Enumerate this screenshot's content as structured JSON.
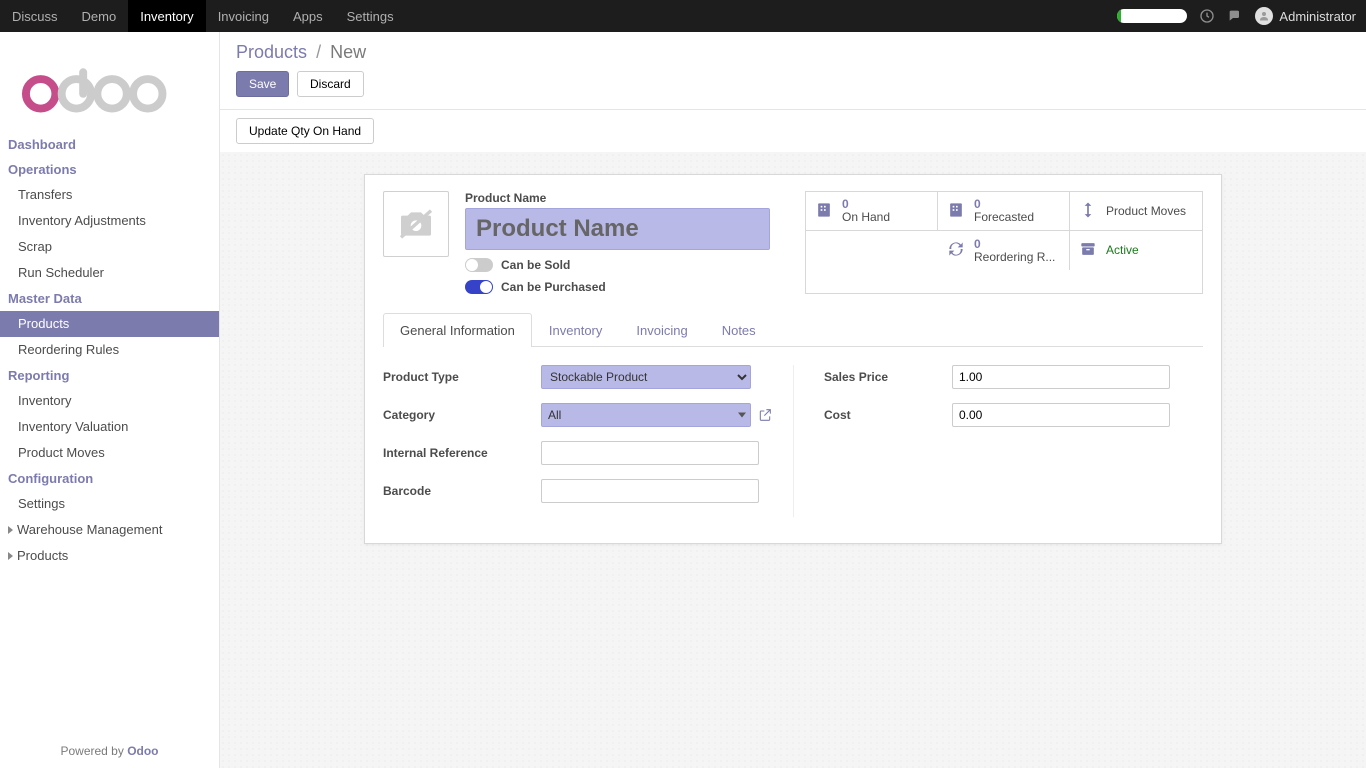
{
  "nav": {
    "items": [
      "Discuss",
      "Demo",
      "Inventory",
      "Invoicing",
      "Apps",
      "Settings"
    ],
    "active_index": 2,
    "user": "Administrator"
  },
  "sidebar": {
    "sections": [
      {
        "title": "Dashboard",
        "links": []
      },
      {
        "title": "Operations",
        "links": [
          {
            "label": "Transfers"
          },
          {
            "label": "Inventory Adjustments"
          },
          {
            "label": "Scrap"
          },
          {
            "label": "Run Scheduler"
          }
        ]
      },
      {
        "title": "Master Data",
        "links": [
          {
            "label": "Products",
            "active": true
          },
          {
            "label": "Reordering Rules"
          }
        ]
      },
      {
        "title": "Reporting",
        "links": [
          {
            "label": "Inventory"
          },
          {
            "label": "Inventory Valuation"
          },
          {
            "label": "Product Moves"
          }
        ]
      },
      {
        "title": "Configuration",
        "links": [
          {
            "label": "Settings"
          }
        ],
        "expanders": [
          {
            "label": "Warehouse Management"
          },
          {
            "label": "Products"
          }
        ]
      }
    ],
    "powered": {
      "prefix": "Powered by ",
      "brand": "Odoo"
    }
  },
  "breadcrumb": {
    "root": "Products",
    "current": "New"
  },
  "buttons": {
    "save": "Save",
    "discard": "Discard",
    "update_qty": "Update Qty On Hand"
  },
  "form": {
    "name_label": "Product Name",
    "name_placeholder": "Product Name",
    "can_be_sold": {
      "label": "Can be Sold",
      "on": false
    },
    "can_be_purchased": {
      "label": "Can be Purchased",
      "on": true
    }
  },
  "stats": {
    "on_hand": {
      "num": "0",
      "label": "On Hand"
    },
    "forecasted": {
      "num": "0",
      "label": "Forecasted"
    },
    "moves": {
      "label": "Product Moves"
    },
    "reorder": {
      "num": "0",
      "label": "Reordering R..."
    },
    "active": {
      "label": "Active"
    }
  },
  "tabs": [
    "General Information",
    "Inventory",
    "Invoicing",
    "Notes"
  ],
  "tab_active_index": 0,
  "fields": {
    "product_type": {
      "label": "Product Type",
      "value": "Stockable Product"
    },
    "category": {
      "label": "Category",
      "value": "All"
    },
    "internal_ref": {
      "label": "Internal Reference",
      "value": ""
    },
    "barcode": {
      "label": "Barcode",
      "value": ""
    },
    "sales_price": {
      "label": "Sales Price",
      "value": "1.00"
    },
    "cost": {
      "label": "Cost",
      "value": "0.00"
    }
  }
}
